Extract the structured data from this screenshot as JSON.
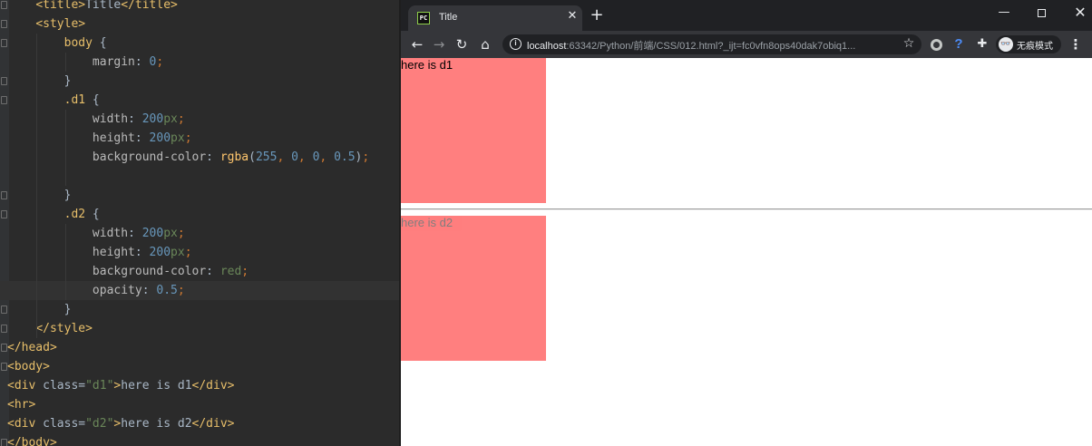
{
  "editor": {
    "lines": [
      {
        "indent": "    ",
        "tokens": [
          [
            "tag",
            "<title>"
          ],
          [
            "txt",
            "Title"
          ],
          [
            "tag",
            "</title>"
          ]
        ]
      },
      {
        "indent": "    ",
        "tokens": [
          [
            "tag",
            "<style>"
          ]
        ]
      },
      {
        "indent": "        ",
        "tokens": [
          [
            "sel",
            "body"
          ],
          [
            "txt",
            " {"
          ]
        ]
      },
      {
        "indent": "            ",
        "tokens": [
          [
            "prop",
            "margin"
          ],
          [
            "txt",
            ": "
          ],
          [
            "num",
            "0"
          ],
          [
            "kw",
            ";"
          ]
        ]
      },
      {
        "indent": "        ",
        "tokens": [
          [
            "txt",
            "}"
          ]
        ]
      },
      {
        "indent": "        ",
        "tokens": [
          [
            "sel",
            ".d1"
          ],
          [
            "txt",
            " {"
          ]
        ]
      },
      {
        "indent": "            ",
        "tokens": [
          [
            "prop",
            "width"
          ],
          [
            "txt",
            ": "
          ],
          [
            "num",
            "200"
          ],
          [
            "str",
            "px"
          ],
          [
            "kw",
            ";"
          ]
        ]
      },
      {
        "indent": "            ",
        "tokens": [
          [
            "prop",
            "height"
          ],
          [
            "txt",
            ": "
          ],
          [
            "num",
            "200"
          ],
          [
            "str",
            "px"
          ],
          [
            "kw",
            ";"
          ]
        ]
      },
      {
        "indent": "            ",
        "tokens": [
          [
            "prop",
            "background-color"
          ],
          [
            "txt",
            ": "
          ],
          [
            "fn",
            "rgba"
          ],
          [
            "txt",
            "("
          ],
          [
            "num",
            "255"
          ],
          [
            "kw",
            ", "
          ],
          [
            "num",
            "0"
          ],
          [
            "kw",
            ", "
          ],
          [
            "num",
            "0"
          ],
          [
            "kw",
            ", "
          ],
          [
            "num",
            "0.5"
          ],
          [
            "txt",
            ")"
          ],
          [
            "kw",
            ";"
          ]
        ]
      },
      {
        "indent": "",
        "tokens": []
      },
      {
        "indent": "        ",
        "tokens": [
          [
            "txt",
            "}"
          ]
        ]
      },
      {
        "indent": "        ",
        "tokens": [
          [
            "sel",
            ".d2"
          ],
          [
            "txt",
            " {"
          ]
        ]
      },
      {
        "indent": "            ",
        "tokens": [
          [
            "prop",
            "width"
          ],
          [
            "txt",
            ": "
          ],
          [
            "num",
            "200"
          ],
          [
            "str",
            "px"
          ],
          [
            "kw",
            ";"
          ]
        ]
      },
      {
        "indent": "            ",
        "tokens": [
          [
            "prop",
            "height"
          ],
          [
            "txt",
            ": "
          ],
          [
            "num",
            "200"
          ],
          [
            "str",
            "px"
          ],
          [
            "kw",
            ";"
          ]
        ]
      },
      {
        "indent": "            ",
        "tokens": [
          [
            "prop",
            "background-color"
          ],
          [
            "txt",
            ": "
          ],
          [
            "str",
            "red"
          ],
          [
            "kw",
            ";"
          ]
        ]
      },
      {
        "indent": "            ",
        "tokens": [
          [
            "prop",
            "opacity"
          ],
          [
            "txt",
            ": "
          ],
          [
            "num",
            "0.5"
          ],
          [
            "kw",
            ";"
          ]
        ]
      },
      {
        "indent": "        ",
        "tokens": [
          [
            "txt",
            "}"
          ]
        ]
      },
      {
        "indent": "    ",
        "tokens": [
          [
            "tag",
            "</style>"
          ]
        ]
      },
      {
        "indent": "",
        "tokens": [
          [
            "tag",
            "</head>"
          ]
        ]
      },
      {
        "indent": "",
        "tokens": [
          [
            "tag",
            "<body>"
          ]
        ]
      },
      {
        "indent": "",
        "tokens": [
          [
            "tag",
            "<div "
          ],
          [
            "txt",
            "class"
          ],
          [
            "txt",
            "="
          ],
          [
            "str",
            "\"d1\""
          ],
          [
            "tag",
            ">"
          ],
          [
            "txt",
            "here is d1"
          ],
          [
            "tag",
            "</div>"
          ]
        ]
      },
      {
        "indent": "",
        "tokens": [
          [
            "tag",
            "<hr>"
          ]
        ]
      },
      {
        "indent": "",
        "tokens": [
          [
            "tag",
            "<div "
          ],
          [
            "txt",
            "class"
          ],
          [
            "txt",
            "="
          ],
          [
            "str",
            "\"d2\""
          ],
          [
            "tag",
            ">"
          ],
          [
            "txt",
            "here is d2"
          ],
          [
            "tag",
            "</div>"
          ]
        ]
      },
      {
        "indent": "",
        "tokens": [
          [
            "tag",
            "</body>"
          ]
        ]
      }
    ],
    "current_line": 15,
    "colors": {
      "background": "#2b2b2b",
      "tag": "#e8bf6a",
      "number": "#6897bb",
      "string": "#6a8759",
      "text": "#a9b7c6"
    }
  },
  "browser": {
    "tab": {
      "title": "Title",
      "favicon": "pycharm-icon",
      "close_glyph": "✕"
    },
    "new_tab_glyph": "+",
    "window_controls": {
      "minimize": "—",
      "close": "✕"
    },
    "toolbar": {
      "back_glyph": "←",
      "forward_glyph": "→",
      "reload_glyph": "↻",
      "home_glyph": "⌂",
      "info_glyph": "i",
      "url_host": "localhost",
      "url_rest": ":63342/Python/前端/CSS/012.html?_ijt=fc0vfn8ops40dak7obiq1...",
      "star_glyph": "☆",
      "help_glyph": "?",
      "puzzle_glyph": "✚",
      "incognito_avatar": "👓",
      "incognito_label": "无痕模式",
      "menu_glyph": "⋮"
    },
    "page": {
      "d1_text": "here is d1",
      "d2_text": "here is d2"
    },
    "colors": {
      "chrome_dark": "#202124",
      "chrome_toolbar": "#35363a",
      "d1_background": "rgba(255, 0, 0, 0.5)",
      "d2_background": "red",
      "d2_opacity": "0.5"
    }
  }
}
